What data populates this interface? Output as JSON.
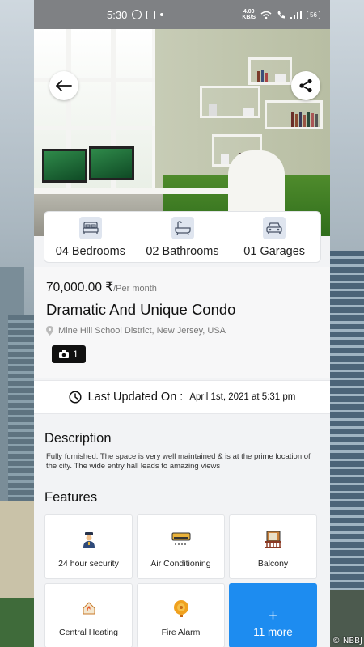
{
  "status_bar": {
    "time": "5:30",
    "net_speed": "4.00",
    "net_unit": "KB/S",
    "battery": "56"
  },
  "amenities": [
    {
      "label": "04 Bedrooms",
      "icon": "bed-icon"
    },
    {
      "label": "02 Bathrooms",
      "icon": "bathtub-icon"
    },
    {
      "label": "01 Garages",
      "icon": "car-icon"
    }
  ],
  "listing": {
    "price": "70,000.00 ₹",
    "price_period": "/Per month",
    "title": "Dramatic And Unique Condo",
    "location": "Mine Hill School District, New Jersey, USA",
    "photo_count": "1"
  },
  "updated": {
    "label": "Last Updated On :",
    "date": "April 1st, 2021 at 5:31 pm"
  },
  "description": {
    "heading": "Description",
    "text": "Fully furnished. The space is very well maintained & is at the prime location of the city. The wide entry hall leads to amazing views"
  },
  "features": {
    "heading": "Features",
    "items": [
      {
        "label": "24 hour security",
        "icon": "security-guard-icon"
      },
      {
        "label": "Air Conditioning",
        "icon": "air-conditioner-icon"
      },
      {
        "label": "Balcony",
        "icon": "balcony-icon"
      },
      {
        "label": "Central Heating",
        "icon": "heating-icon"
      },
      {
        "label": "Fire Alarm",
        "icon": "fire-alarm-icon"
      }
    ],
    "more_plus": "+",
    "more_label": "11 more"
  },
  "watermark": "© NBBJ",
  "colors": {
    "accent": "#1d8cf0",
    "status_bar": "#7f8184",
    "badge": "#111111"
  }
}
